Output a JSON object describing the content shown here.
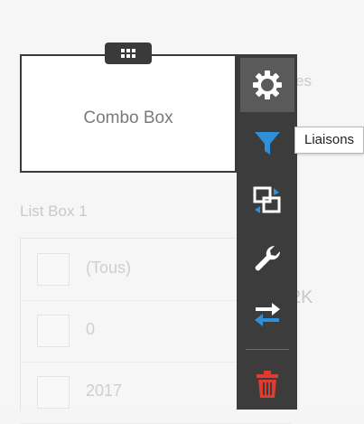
{
  "colors": {
    "toolbar_bg": "#3c3c3c",
    "accent_blue": "#2f8fd8",
    "delete_red": "#e23a2e",
    "icon_white": "#ffffff"
  },
  "background": {
    "partial_label_top": "es",
    "listbox_title": "List Box 1",
    "partial_value": "2K",
    "listbox_items": [
      "(Tous)",
      "0",
      "2017"
    ]
  },
  "combo_box": {
    "label": "Combo Box"
  },
  "toolbar": {
    "buttons": [
      {
        "name": "settings",
        "icon": "gear-icon"
      },
      {
        "name": "filter",
        "icon": "filter-icon"
      },
      {
        "name": "replace",
        "icon": "swap-widget-icon"
      },
      {
        "name": "tools",
        "icon": "wrench-icon"
      },
      {
        "name": "exchange",
        "icon": "arrows-exchange-icon"
      },
      {
        "name": "delete",
        "icon": "trash-icon"
      }
    ]
  },
  "tooltip": {
    "text": "Liaisons"
  }
}
